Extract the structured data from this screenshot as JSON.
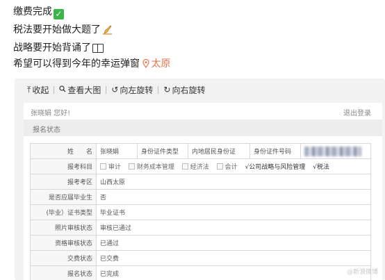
{
  "post": {
    "line1": "缴费完成",
    "line2": "税法要开始做大题了",
    "line3": "战略要开始背诵了",
    "line4": "希望可以得到今年的幸运弹窗",
    "location": "太原",
    "icons": [
      "check-mark-emoji",
      "writing-hand-emoji",
      "open-book-emoji",
      "location-pin-icon"
    ]
  },
  "toolbar": {
    "collapse": "收起",
    "view_large": "查看大图",
    "rotate_left": "向左旋转",
    "rotate_right": "向右旋转"
  },
  "screenshot": {
    "greeting": "张晓娟 您好!",
    "logout": "退出登录",
    "section_title": "报名状态",
    "name_label": "姓　　名",
    "name_value": "张晓娟",
    "id_type_label": "身份证件类型",
    "id_type_value": "内地居民身份证",
    "id_number_label": "身份证件号码",
    "subjects_label": "报考科目",
    "subjects": [
      {
        "name": "审计",
        "checked": false
      },
      {
        "name": "财务成本管理",
        "checked": false
      },
      {
        "name": "经济法",
        "checked": false
      },
      {
        "name": "会计",
        "checked": false
      },
      {
        "name": "√公司战略与风险管理",
        "checked": true
      },
      {
        "name": "√税法",
        "checked": true
      }
    ],
    "rows": [
      {
        "label": "报考考区",
        "value": "山西太原"
      },
      {
        "label": "是否应届毕业生",
        "value": "否"
      },
      {
        "label": "(毕业）证书类型",
        "value": "毕业证书"
      },
      {
        "label": "照片审核状态",
        "value": "审核已通过"
      },
      {
        "label": "资格审核状态",
        "value": "已通过"
      },
      {
        "label": "交费状态",
        "value": "已交费"
      },
      {
        "label": "报名状态",
        "value": "已完成"
      }
    ],
    "watermark": "@新浪微博"
  },
  "colors": {
    "location": "#eb7350",
    "check_emoji": "#3bb54a",
    "card_bg": "#f2f2f2"
  }
}
